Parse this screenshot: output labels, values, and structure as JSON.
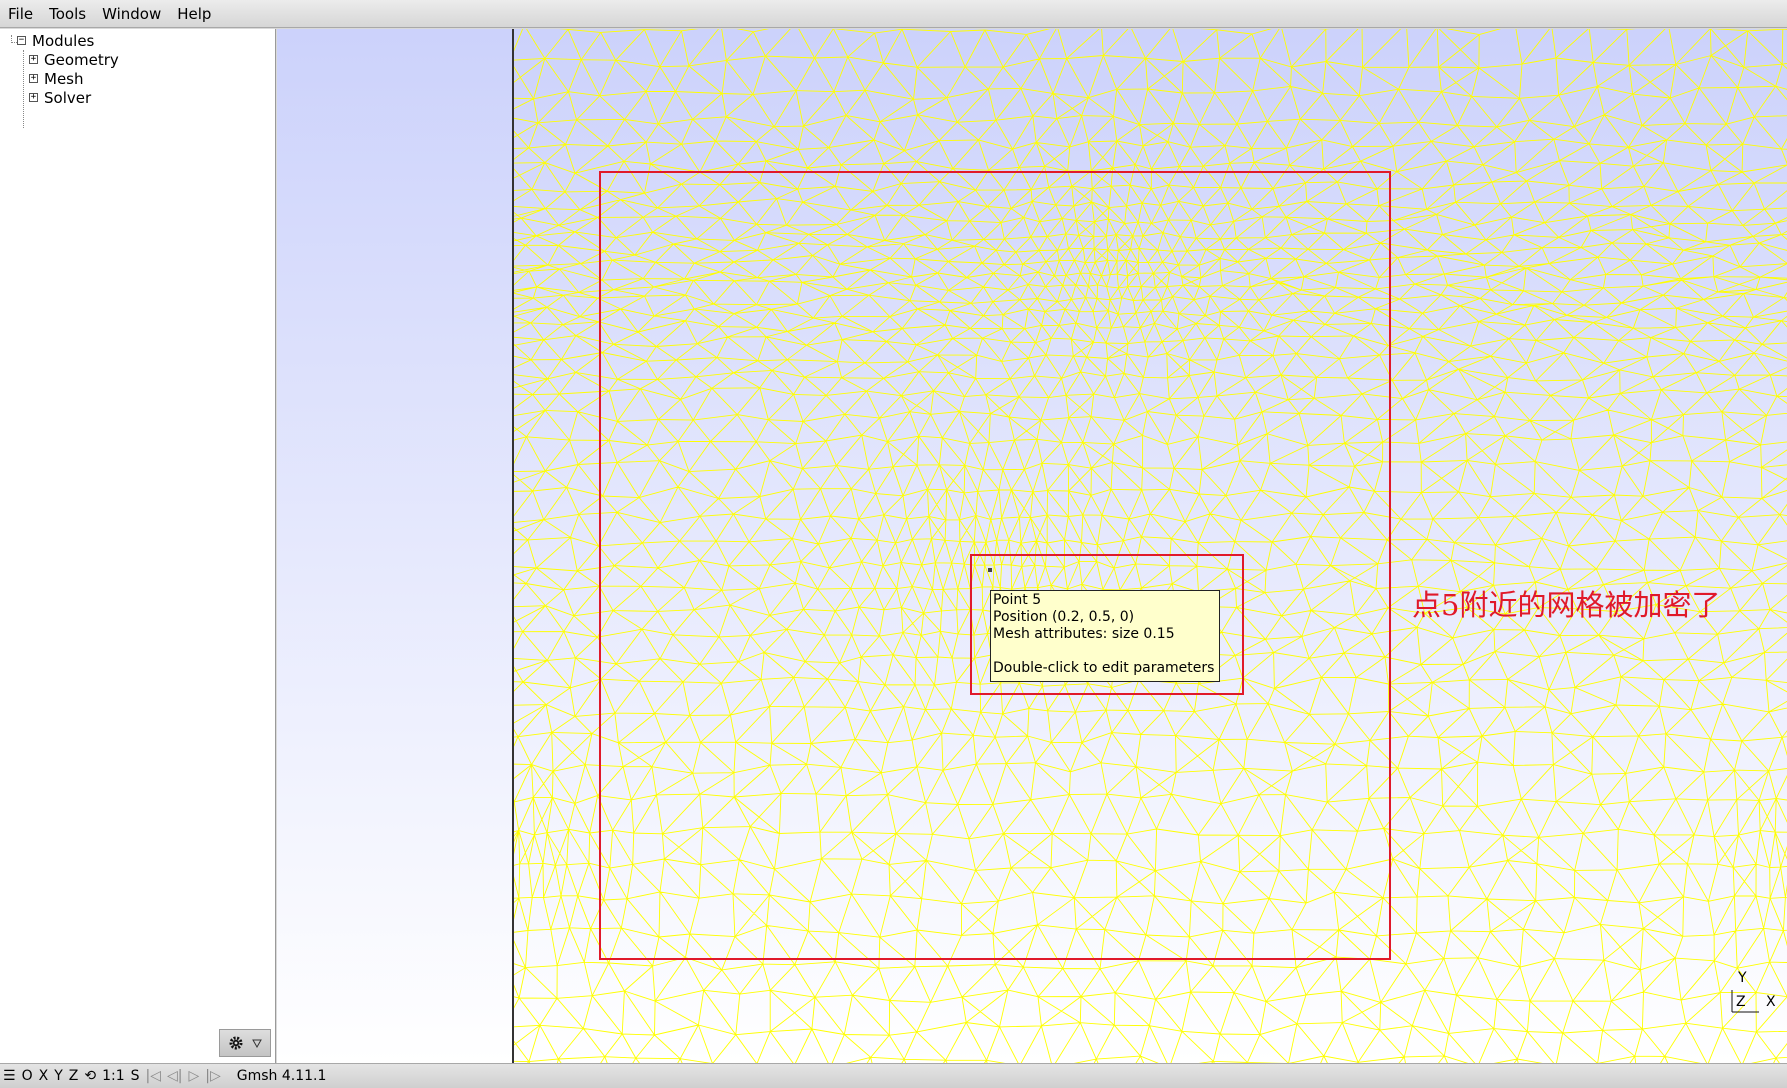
{
  "menu": [
    "File",
    "Tools",
    "Window",
    "Help"
  ],
  "tree": {
    "root": "Modules",
    "items": [
      "Geometry",
      "Mesh",
      "Solver"
    ]
  },
  "viewport": {
    "tooltip_lines": [
      "Point 5",
      "Position (0.2, 0.5, 0)",
      "Mesh attributes: size 0.15",
      "",
      "Double-click to edit parameters"
    ],
    "annotation": "点5附近的网格被加密了",
    "axis_labels": {
      "y": "Y",
      "z": "Z",
      "x": "X"
    }
  },
  "statusbar": {
    "o": "O",
    "x": "X",
    "y": "Y",
    "z": "Z",
    "scale": "1:1",
    "s": "S",
    "version": "Gmsh 4.11.1"
  },
  "colors": {
    "mesh": "#ffff00",
    "annotation": "#e0192a",
    "tooltip_bg": "#ffffcc",
    "bg_top": "#ccd2fb",
    "bg_bottom": "#ffffff"
  }
}
